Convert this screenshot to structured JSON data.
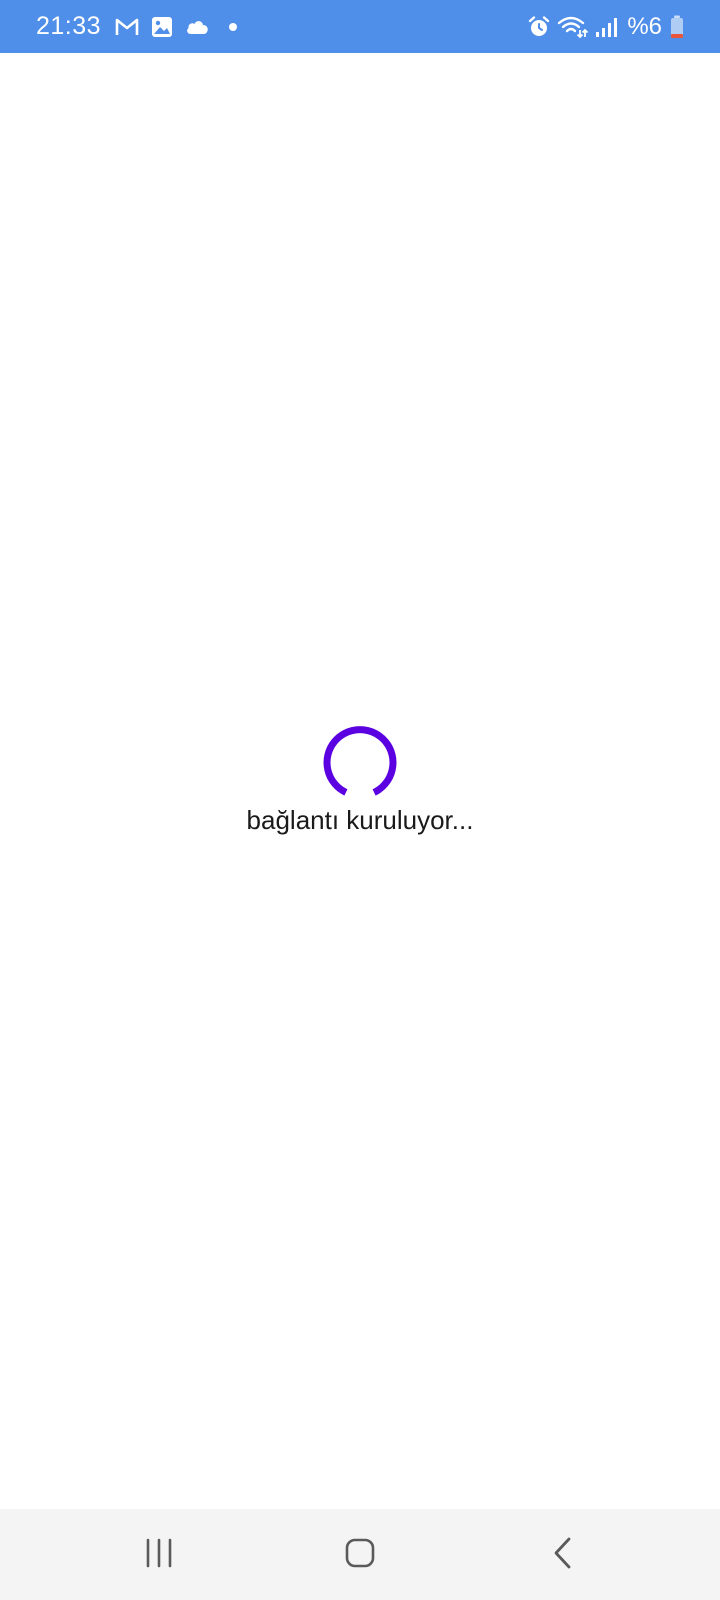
{
  "status_bar": {
    "background_color": "#4f8ee9",
    "time": "21:33",
    "battery_text": "%6",
    "left_icons": [
      "gmail-icon",
      "gallery-icon",
      "cloud-icon",
      "notification-dot-icon"
    ],
    "right_icons": [
      "alarm-icon",
      "wifi-icon",
      "signal-icon",
      "battery-icon"
    ]
  },
  "main": {
    "spinner_color": "#5b00e0",
    "loading_text": "bağlantı kuruluyor..."
  },
  "nav_bar": {
    "background_color": "#f4f4f4",
    "buttons": [
      "recent-apps-icon",
      "home-icon",
      "back-icon"
    ]
  }
}
